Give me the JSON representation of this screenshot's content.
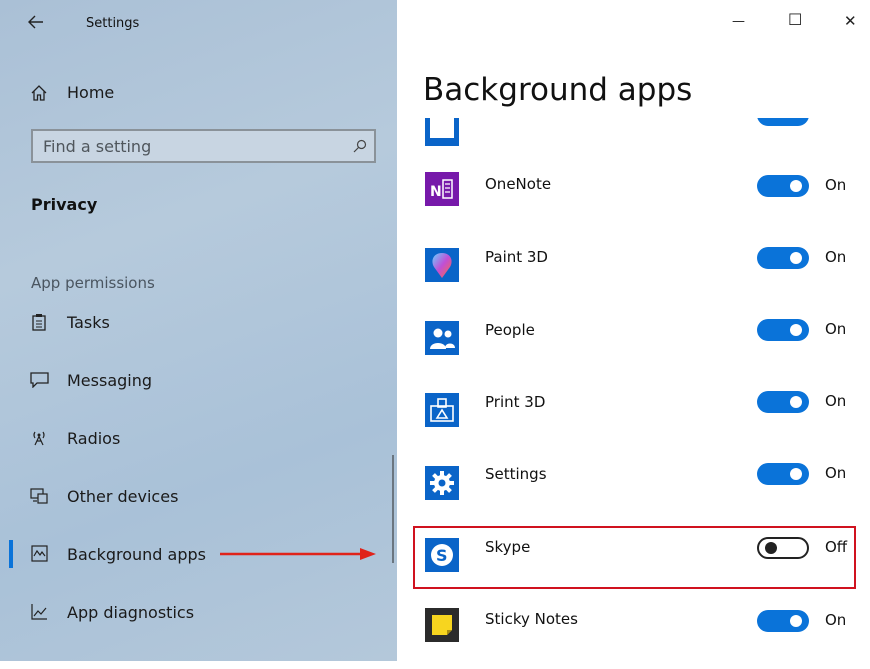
{
  "window": {
    "title": "Settings",
    "minimize_glyph": "—",
    "maximize_glyph": "☐",
    "close_glyph": "✕"
  },
  "sidebar": {
    "home_label": "Home",
    "search_placeholder": "Find a setting",
    "section_title": "Privacy",
    "group_label": "App permissions",
    "items": [
      {
        "label": "Tasks",
        "icon": "clipboard-icon"
      },
      {
        "label": "Messaging",
        "icon": "chat-bubble-icon"
      },
      {
        "label": "Radios",
        "icon": "antenna-icon"
      },
      {
        "label": "Other devices",
        "icon": "devices-icon"
      },
      {
        "label": "Background apps",
        "icon": "background-apps-icon",
        "selected": true
      },
      {
        "label": "App diagnostics",
        "icon": "chart-icon"
      }
    ],
    "accent_color": "#0a73d9"
  },
  "main": {
    "page_title": "Background apps",
    "apps": [
      {
        "name": "OneNote",
        "state": "On",
        "icon": "onenote-icon"
      },
      {
        "name": "Paint 3D",
        "state": "On",
        "icon": "paint3d-icon"
      },
      {
        "name": "People",
        "state": "On",
        "icon": "people-icon"
      },
      {
        "name": "Print 3D",
        "state": "On",
        "icon": "print3d-icon"
      },
      {
        "name": "Settings",
        "state": "On",
        "icon": "settings-gear-icon"
      },
      {
        "name": "Skype",
        "state": "Off",
        "icon": "skype-icon",
        "highlighted": true
      },
      {
        "name": "Sticky Notes",
        "state": "On",
        "icon": "sticky-notes-icon"
      }
    ]
  },
  "annotation": {
    "highlight_color": "#d0121f",
    "arrow_color": "#e0231a"
  }
}
